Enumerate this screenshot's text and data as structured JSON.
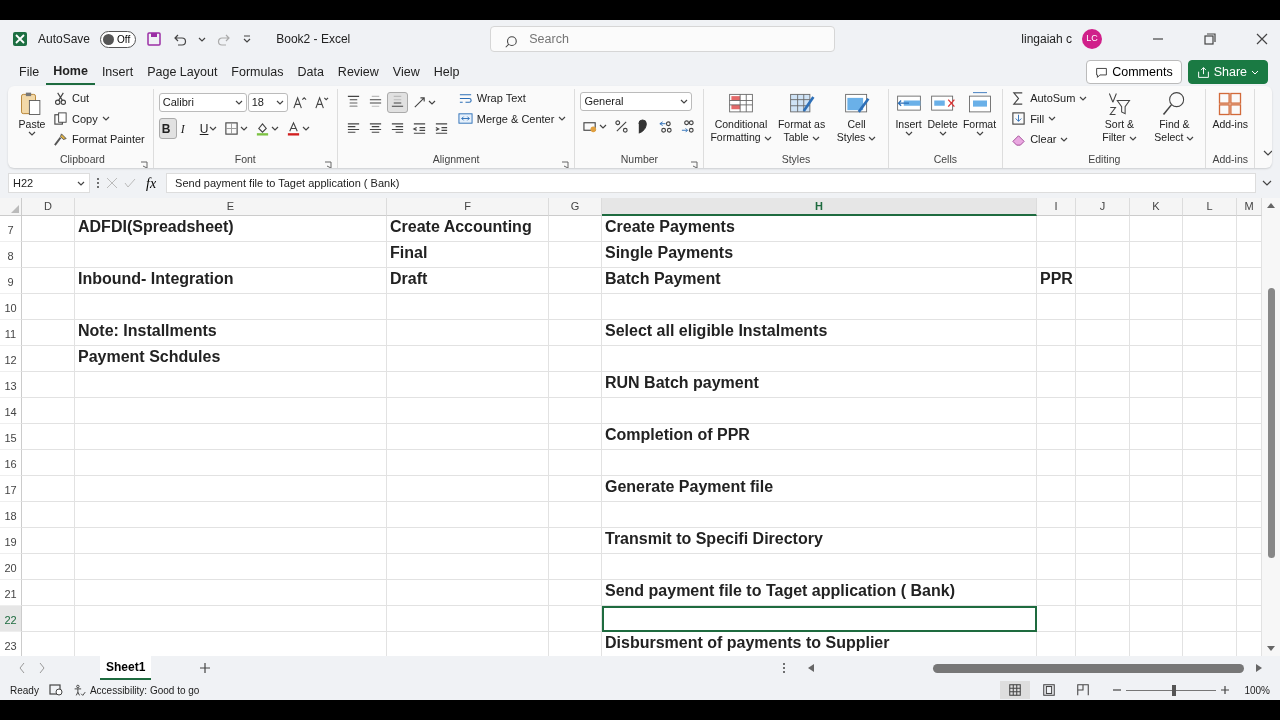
{
  "window": {
    "title": "Book2 - Excel"
  },
  "autosave": {
    "label": "AutoSave",
    "on": false,
    "state_text": "Off"
  },
  "search": {
    "placeholder": "Search"
  },
  "account": {
    "name": "lingaiah c",
    "initials": "LC"
  },
  "menu_tabs": [
    {
      "label": "File",
      "selected": false
    },
    {
      "label": "Home",
      "selected": true
    },
    {
      "label": "Insert",
      "selected": false
    },
    {
      "label": "Page Layout",
      "selected": false
    },
    {
      "label": "Formulas",
      "selected": false
    },
    {
      "label": "Data",
      "selected": false
    },
    {
      "label": "Review",
      "selected": false
    },
    {
      "label": "View",
      "selected": false
    },
    {
      "label": "Help",
      "selected": false
    }
  ],
  "header_buttons": [
    {
      "kind": "comments",
      "label": "Comments"
    },
    {
      "kind": "share",
      "label": "Share"
    }
  ],
  "ribbon": {
    "groups": [
      {
        "label": "Clipboard",
        "launcher": true,
        "sections": [
          {
            "kind": "large",
            "items": [
              {
                "kind": "paste",
                "label": "Paste",
                "dropdown": true
              }
            ]
          },
          {
            "kind": "stack",
            "items": [
              {
                "kind": "cut",
                "label": "Cut"
              },
              {
                "kind": "copy",
                "label": "Copy",
                "dropdown": true
              },
              {
                "kind": "format-painter",
                "label": "Format Painter"
              }
            ]
          }
        ]
      },
      {
        "label": "Font",
        "launcher": true,
        "sections": [
          {
            "kind": "tools",
            "lines": [
              {
                "items": [
                  {
                    "kind": "font-name",
                    "value": "Calibri"
                  },
                  {
                    "kind": "font-size",
                    "value": "18"
                  },
                  {
                    "kind": "grow-font"
                  },
                  {
                    "kind": "shrink-font"
                  }
                ]
              },
              {
                "items": [
                  {
                    "kind": "bold",
                    "text": "B",
                    "selected": true
                  },
                  {
                    "kind": "italic",
                    "text": "I",
                    "selected": false
                  },
                  {
                    "kind": "underline",
                    "text": "U",
                    "selected": false,
                    "dropdown": true
                  },
                  {
                    "kind": "borders",
                    "dropdown": true
                  },
                  {
                    "kind": "fill-color",
                    "dropdown": true
                  },
                  {
                    "kind": "font-color",
                    "dropdown": true
                  }
                ]
              }
            ]
          }
        ]
      },
      {
        "label": "Alignment",
        "launcher": true,
        "sections": [
          {
            "kind": "tools",
            "lines": [
              {
                "items": [
                  {
                    "kind": "align-top",
                    "selected": false
                  },
                  {
                    "kind": "align-middle",
                    "selected": false
                  },
                  {
                    "kind": "align-bottom",
                    "selected": true
                  },
                  {
                    "kind": "orientation",
                    "dropdown": true
                  }
                ]
              },
              {
                "items": [
                  {
                    "kind": "align-left",
                    "selected": false
                  },
                  {
                    "kind": "align-center",
                    "selected": false
                  },
                  {
                    "kind": "align-right",
                    "selected": false
                  },
                  {
                    "kind": "decrease-indent"
                  },
                  {
                    "kind": "increase-indent"
                  }
                ]
              }
            ]
          },
          {
            "kind": "stack",
            "items": [
              {
                "kind": "wrap-text",
                "label": "Wrap Text"
              },
              {
                "kind": "merge-center",
                "label": "Merge & Center",
                "dropdown": true
              }
            ]
          }
        ]
      },
      {
        "label": "Number",
        "launcher": true,
        "sections": [
          {
            "kind": "tools",
            "lines": [
              {
                "items": [
                  {
                    "kind": "number-format",
                    "value": "General"
                  }
                ]
              },
              {
                "items": [
                  {
                    "kind": "accounting",
                    "dropdown": true
                  },
                  {
                    "kind": "percent"
                  },
                  {
                    "kind": "comma"
                  },
                  {
                    "kind": "increase-decimal"
                  },
                  {
                    "kind": "decrease-decimal"
                  }
                ]
              }
            ]
          }
        ]
      },
      {
        "label": "Styles",
        "sections": [
          {
            "kind": "large",
            "items": [
              {
                "kind": "conditional-formatting",
                "label": "Conditional Formatting",
                "dropdown": true
              },
              {
                "kind": "format-table",
                "label": "Format as Table",
                "dropdown": true
              },
              {
                "kind": "cell-styles",
                "label": "Cell Styles",
                "dropdown": true
              }
            ]
          }
        ]
      },
      {
        "label": "Cells",
        "sections": [
          {
            "kind": "large",
            "items": [
              {
                "kind": "insert",
                "label": "Insert",
                "dropdown": true
              },
              {
                "kind": "delete",
                "label": "Delete",
                "dropdown": true
              },
              {
                "kind": "format",
                "label": "Format",
                "dropdown": true
              }
            ]
          }
        ]
      },
      {
        "label": "Editing",
        "sections": [
          {
            "kind": "stack",
            "items": [
              {
                "kind": "autosum",
                "label": "AutoSum",
                "dropdown": true
              },
              {
                "kind": "fill",
                "label": "Fill",
                "dropdown": true
              },
              {
                "kind": "clear",
                "label": "Clear",
                "dropdown": true
              }
            ]
          },
          {
            "kind": "large",
            "items": [
              {
                "kind": "sort-filter",
                "label": "Sort & Filter",
                "dropdown": true
              },
              {
                "kind": "find-select",
                "label": "Find & Select",
                "dropdown": true
              }
            ]
          }
        ]
      },
      {
        "label": "Add-ins",
        "sections": [
          {
            "kind": "large",
            "items": [
              {
                "kind": "add-ins",
                "label": "Add-ins"
              }
            ]
          }
        ]
      }
    ]
  },
  "formula_bar": {
    "name_box": "H22",
    "function_label": "fx",
    "formula": "Send payment file to Taget application ( Bank)"
  },
  "sheet": {
    "columns": [
      {
        "label": "D",
        "selected": false
      },
      {
        "label": "E",
        "selected": false
      },
      {
        "label": "F",
        "selected": false
      },
      {
        "label": "G",
        "selected": false
      },
      {
        "label": "H",
        "selected": true
      },
      {
        "label": "I",
        "selected": false
      },
      {
        "label": "J",
        "selected": false
      },
      {
        "label": "K",
        "selected": false
      },
      {
        "label": "L",
        "selected": false
      },
      {
        "label": "M",
        "selected": false
      }
    ],
    "rows": [
      {
        "number": "7",
        "selected": false,
        "cells": {
          "E": "ADFDI(Spreadsheet)",
          "F": "Create Accounting",
          "H": "Create Payments"
        }
      },
      {
        "number": "8",
        "selected": false,
        "cells": {
          "F": "Final",
          "H": "Single Payments"
        }
      },
      {
        "number": "9",
        "selected": false,
        "cells": {
          "E": "Inbound- Integration",
          "F": "Draft",
          "H": "Batch Payment",
          "I": "PPR"
        }
      },
      {
        "number": "10",
        "selected": false,
        "cells": {}
      },
      {
        "number": "11",
        "selected": false,
        "cells": {
          "E": "Note: Installments",
          "H": "Select all eligible Instalments"
        }
      },
      {
        "number": "12",
        "selected": false,
        "cells": {
          "E": "Payment Schdules"
        }
      },
      {
        "number": "13",
        "selected": false,
        "cells": {
          "H": "RUN Batch payment"
        }
      },
      {
        "number": "14",
        "selected": false,
        "cells": {}
      },
      {
        "number": "15",
        "selected": false,
        "cells": {
          "H": "Completion of PPR"
        }
      },
      {
        "number": "16",
        "selected": false,
        "cells": {}
      },
      {
        "number": "17",
        "selected": false,
        "cells": {
          "H": "Generate Payment file"
        }
      },
      {
        "number": "18",
        "selected": false,
        "cells": {}
      },
      {
        "number": "19",
        "selected": false,
        "cells": {
          "H": "Transmit to Specifi Directory"
        }
      },
      {
        "number": "20",
        "selected": false,
        "cells": {}
      },
      {
        "number": "21",
        "selected": false,
        "cells": {
          "H": "Send payment file to Taget application ( Bank)"
        }
      },
      {
        "number": "22",
        "selected": true,
        "cells": {}
      },
      {
        "number": "23",
        "selected": false,
        "cells": {
          "H": "Disbursment of payments to Supplier"
        }
      }
    ]
  },
  "sheet_tabs": [
    {
      "label": "Sheet1",
      "selected": true
    }
  ],
  "status_bar": {
    "status": "Ready",
    "accessibility": "Accessibility: Good to go",
    "views": [
      {
        "kind": "normal",
        "selected": true
      },
      {
        "kind": "page-layout",
        "selected": false
      },
      {
        "kind": "page-break",
        "selected": false
      }
    ],
    "zoom": {
      "level": 0.53,
      "label": "100%"
    }
  }
}
